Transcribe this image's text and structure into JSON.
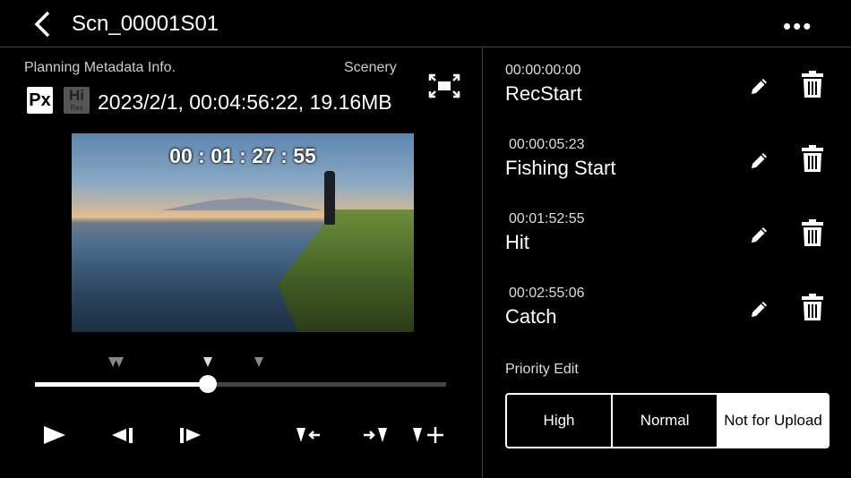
{
  "header": {
    "title": "Scn_00001S01",
    "more": "•••"
  },
  "clip": {
    "planning_label": "Planning Metadata Info.",
    "category": "Scenery",
    "badge_px": "Px",
    "badge_hi": "Hi",
    "badge_res": "Res",
    "meta": "2023/2/1, 00:04:56:22, 19.16MB"
  },
  "player": {
    "timecode": "00 : 01 : 27 : 55",
    "progress": 0.42,
    "marker_positions": [
      0.19,
      0.205,
      0.42,
      0.545
    ]
  },
  "marks": [
    {
      "time": "00:00:00:00",
      "name": "RecStart"
    },
    {
      "time": "00:00:05:23",
      "name": "Fishing Start"
    },
    {
      "time": "00:01:52:55",
      "name": "Hit"
    },
    {
      "time": "00:02:55:06",
      "name": "Catch"
    }
  ],
  "priority": {
    "label": "Priority Edit",
    "options": [
      "High",
      "Normal",
      "Not for Upload"
    ],
    "selected": "Not for Upload"
  }
}
